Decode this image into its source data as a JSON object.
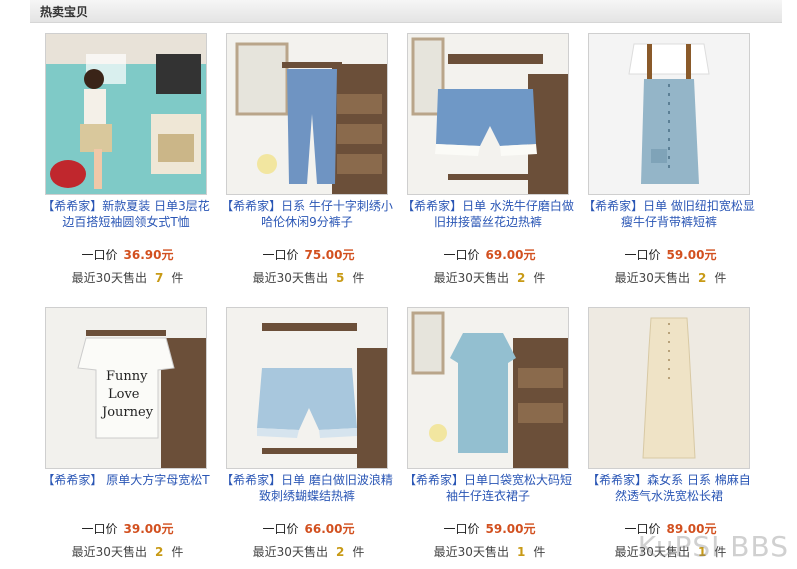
{
  "section": {
    "title": "热卖宝贝"
  },
  "price_label": "一口价",
  "sold_prefix": "最近30天售出",
  "sold_suffix": "件",
  "products": [
    {
      "name": "【希希家】新款夏装 日单3层花边百搭短袖圆领女式T恤",
      "price": "36.90元",
      "sold": "7",
      "image": "magazine-cover-model"
    },
    {
      "name": "【希希家】日系 牛仔十字刺绣小哈伦休闲9分裤子",
      "price": "75.00元",
      "sold": "5",
      "image": "denim-pants-on-shelf"
    },
    {
      "name": "【希希家】日单 水洗牛仔磨白做旧拼接蕾丝花边热裤",
      "price": "69.00元",
      "sold": "2",
      "image": "denim-shorts-on-shelf"
    },
    {
      "name": "【希希家】日单 做旧纽扣宽松显瘦牛仔背带裤短裤",
      "price": "59.00元",
      "sold": "2",
      "image": "denim-overalls"
    },
    {
      "name": "【希希家】 原单大方字母宽松T",
      "price": "39.00元",
      "sold": "2",
      "image": "funny-love-tee"
    },
    {
      "name": "【希希家】日单 磨白做旧波浪精致刺绣蝴蝶结热裤",
      "price": "66.00元",
      "sold": "2",
      "image": "light-denim-shorts"
    },
    {
      "name": "【希希家】日单口袋宽松大码短袖牛仔连衣裙子",
      "price": "59.00元",
      "sold": "1",
      "image": "denim-dress"
    },
    {
      "name": "【希希家】森女系 日系 棉麻自然透气水洗宽松长裙",
      "price": "89.00元",
      "sold": "1",
      "image": "linen-long-dress"
    }
  ],
  "watermark": "KuPSI BBS",
  "colors": {
    "link": "#2a56b5",
    "price": "#d2501f",
    "count": "#c89a16"
  }
}
